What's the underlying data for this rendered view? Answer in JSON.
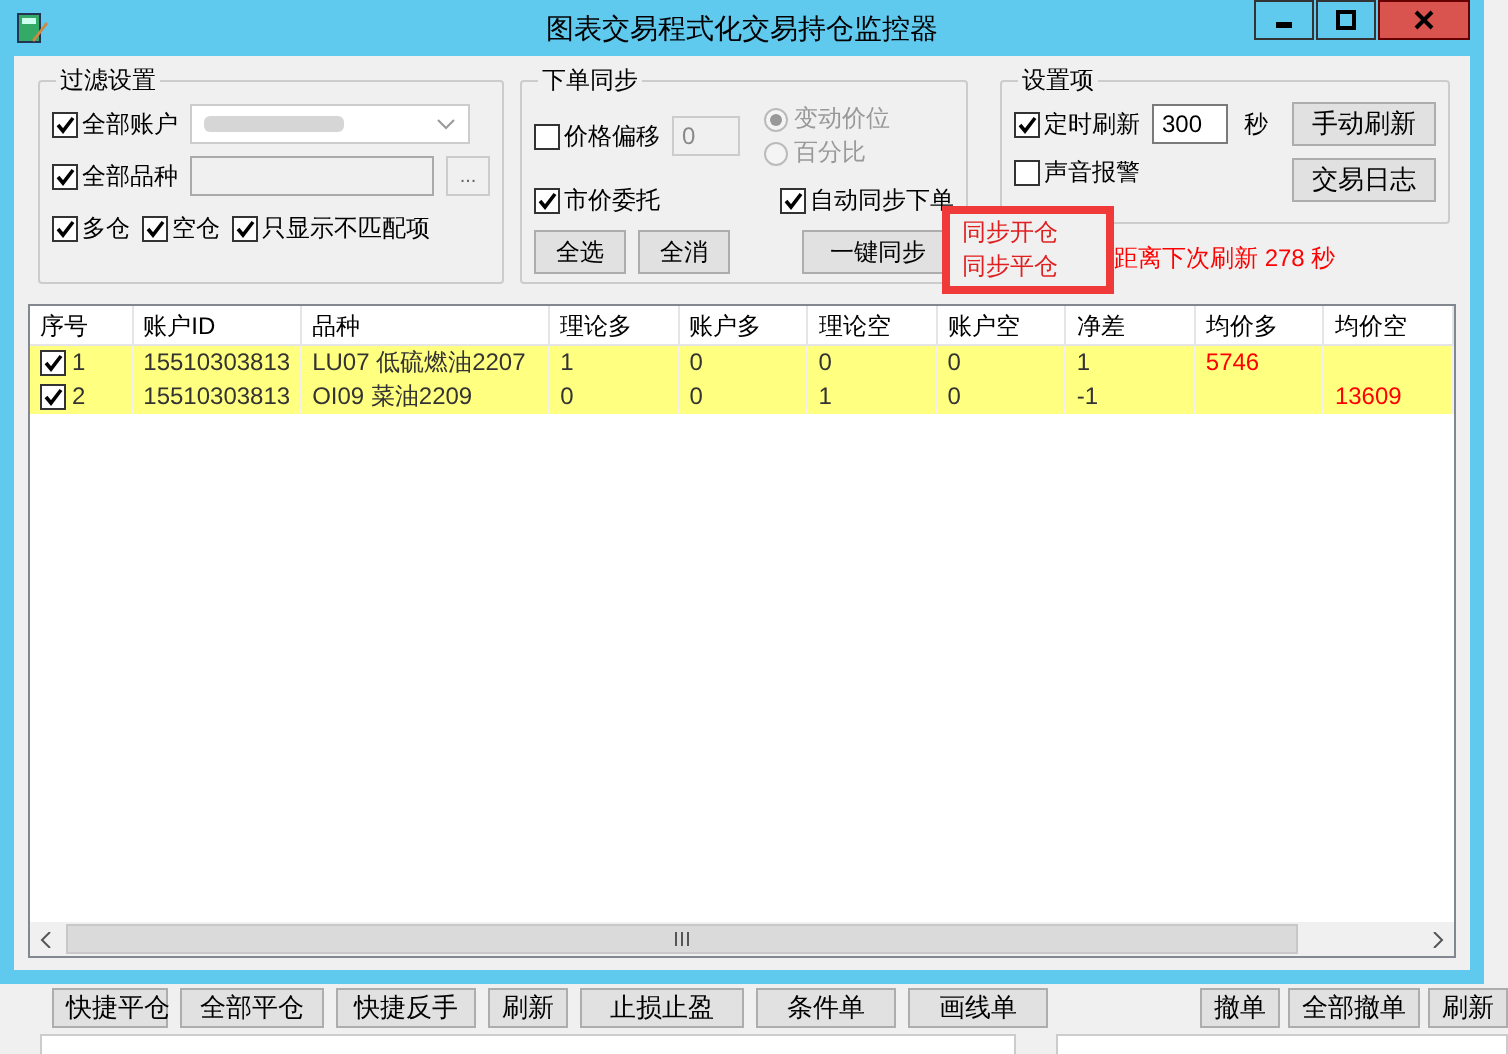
{
  "window": {
    "title": "图表交易程式化交易持仓监控器"
  },
  "filter": {
    "title": "过滤设置",
    "all_accounts": {
      "label": "全部账户",
      "checked": true
    },
    "all_symbols": {
      "label": "全部品种",
      "checked": true
    },
    "browse_button": "...",
    "options": [
      {
        "label": "多仓",
        "checked": true
      },
      {
        "label": "空仓",
        "checked": true
      },
      {
        "label": "只显示不匹配项",
        "checked": true
      }
    ]
  },
  "order_sync": {
    "title": "下单同步",
    "price_offset": {
      "label": "价格偏移",
      "checked": false
    },
    "offset_value": "0",
    "radios_disabled": true,
    "radios": [
      {
        "label": "变动价位",
        "selected": true
      },
      {
        "label": "百分比",
        "selected": false
      }
    ],
    "market_order": {
      "label": "市价委托",
      "checked": true
    },
    "auto_sync": {
      "label": "自动同步下单",
      "checked": true
    },
    "buttons": [
      "全选",
      "全消",
      "一键同步"
    ]
  },
  "settings": {
    "title": "设置项",
    "timer": {
      "label": "定时刷新",
      "checked": true
    },
    "interval": "300",
    "unit": "秒",
    "sound": {
      "label": "声音报警",
      "checked": false
    },
    "buttons": [
      "手动刷新",
      "交易日志"
    ]
  },
  "popup_menu": {
    "items": [
      "同步开仓",
      "同步平仓"
    ]
  },
  "countdown": "距离下次刷新 278 秒",
  "table": {
    "columns": [
      {
        "label": "序号",
        "kind": "plain"
      },
      {
        "label": "账户ID",
        "kind": "plain"
      },
      {
        "label": "品种",
        "kind": "plain"
      },
      {
        "label": "理论多",
        "kind": "plain"
      },
      {
        "label": "账户多",
        "kind": "plain"
      },
      {
        "label": "理论空",
        "kind": "plain"
      },
      {
        "label": "账户空",
        "kind": "plain"
      },
      {
        "label": "净差",
        "kind": "plain"
      },
      {
        "label": "均价多",
        "kind": "price"
      },
      {
        "label": "均价空",
        "kind": "price"
      }
    ],
    "rows": [
      {
        "checked": true,
        "mismatch": true,
        "cells": [
          "1",
          "15510303813",
          "LU07 低硫燃油2207",
          "1",
          "0",
          "0",
          "0",
          "1",
          "5746",
          ""
        ]
      },
      {
        "checked": true,
        "mismatch": true,
        "cells": [
          "2",
          "15510303813",
          "OI09 菜油2209",
          "0",
          "0",
          "1",
          "0",
          "-1",
          "",
          "13609"
        ]
      }
    ]
  },
  "background_toolbar": {
    "left_buttons": [
      "快捷平仓",
      "全部平仓",
      "快捷反手",
      "刷新",
      "止损止盈",
      "条件单",
      "画线单"
    ],
    "right_buttons": [
      "撤单",
      "全部撤单",
      "刷新"
    ]
  }
}
